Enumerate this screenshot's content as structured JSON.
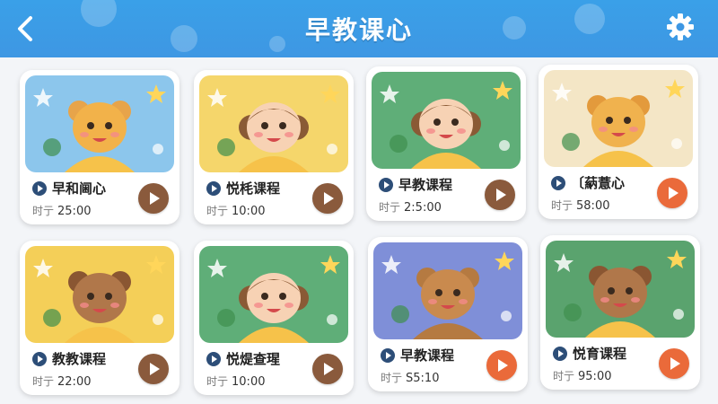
{
  "header": {
    "title": "早教课心",
    "back_icon": "chevron-left-icon",
    "settings_icon": "gear-icon"
  },
  "colors": {
    "header_blue": "#3e97e3",
    "play_brown": "#8a5a3c",
    "play_orange": "#ea6a3a",
    "title_play_navy": "#2d4e78"
  },
  "time_label": "时亍",
  "cards": [
    {
      "title": "早和阃心",
      "time": "25:00",
      "bg": "#8cc6ec",
      "character": "tiger-cat",
      "play_color": "brown"
    },
    {
      "title": "悦枆课程",
      "time": "10:00",
      "bg": "#f5d66b",
      "character": "girl",
      "play_color": "brown"
    },
    {
      "title": "早教课程",
      "time": "2:5:00",
      "bg": "#5fae78",
      "character": "girl-curly",
      "play_color": "brown"
    },
    {
      "title": "〔蒳薏心",
      "time": "58:00",
      "bg": "#f4e6c6",
      "character": "tiger",
      "play_color": "orange"
    },
    {
      "title": "教教课程",
      "time": "22:00",
      "bg": "#f4cf58",
      "character": "monkey",
      "play_color": "brown"
    },
    {
      "title": "悦煶查瑆",
      "time": "10:00",
      "bg": "#5fae78",
      "character": "girl",
      "play_color": "brown"
    },
    {
      "title": "早教课程",
      "time": "S5:10",
      "bg": "#7f8fd8",
      "character": "bear",
      "play_color": "orange"
    },
    {
      "title": "悦育课程",
      "time": "95:00",
      "bg": "#5aa36e",
      "character": "monkey",
      "play_color": "orange"
    }
  ]
}
